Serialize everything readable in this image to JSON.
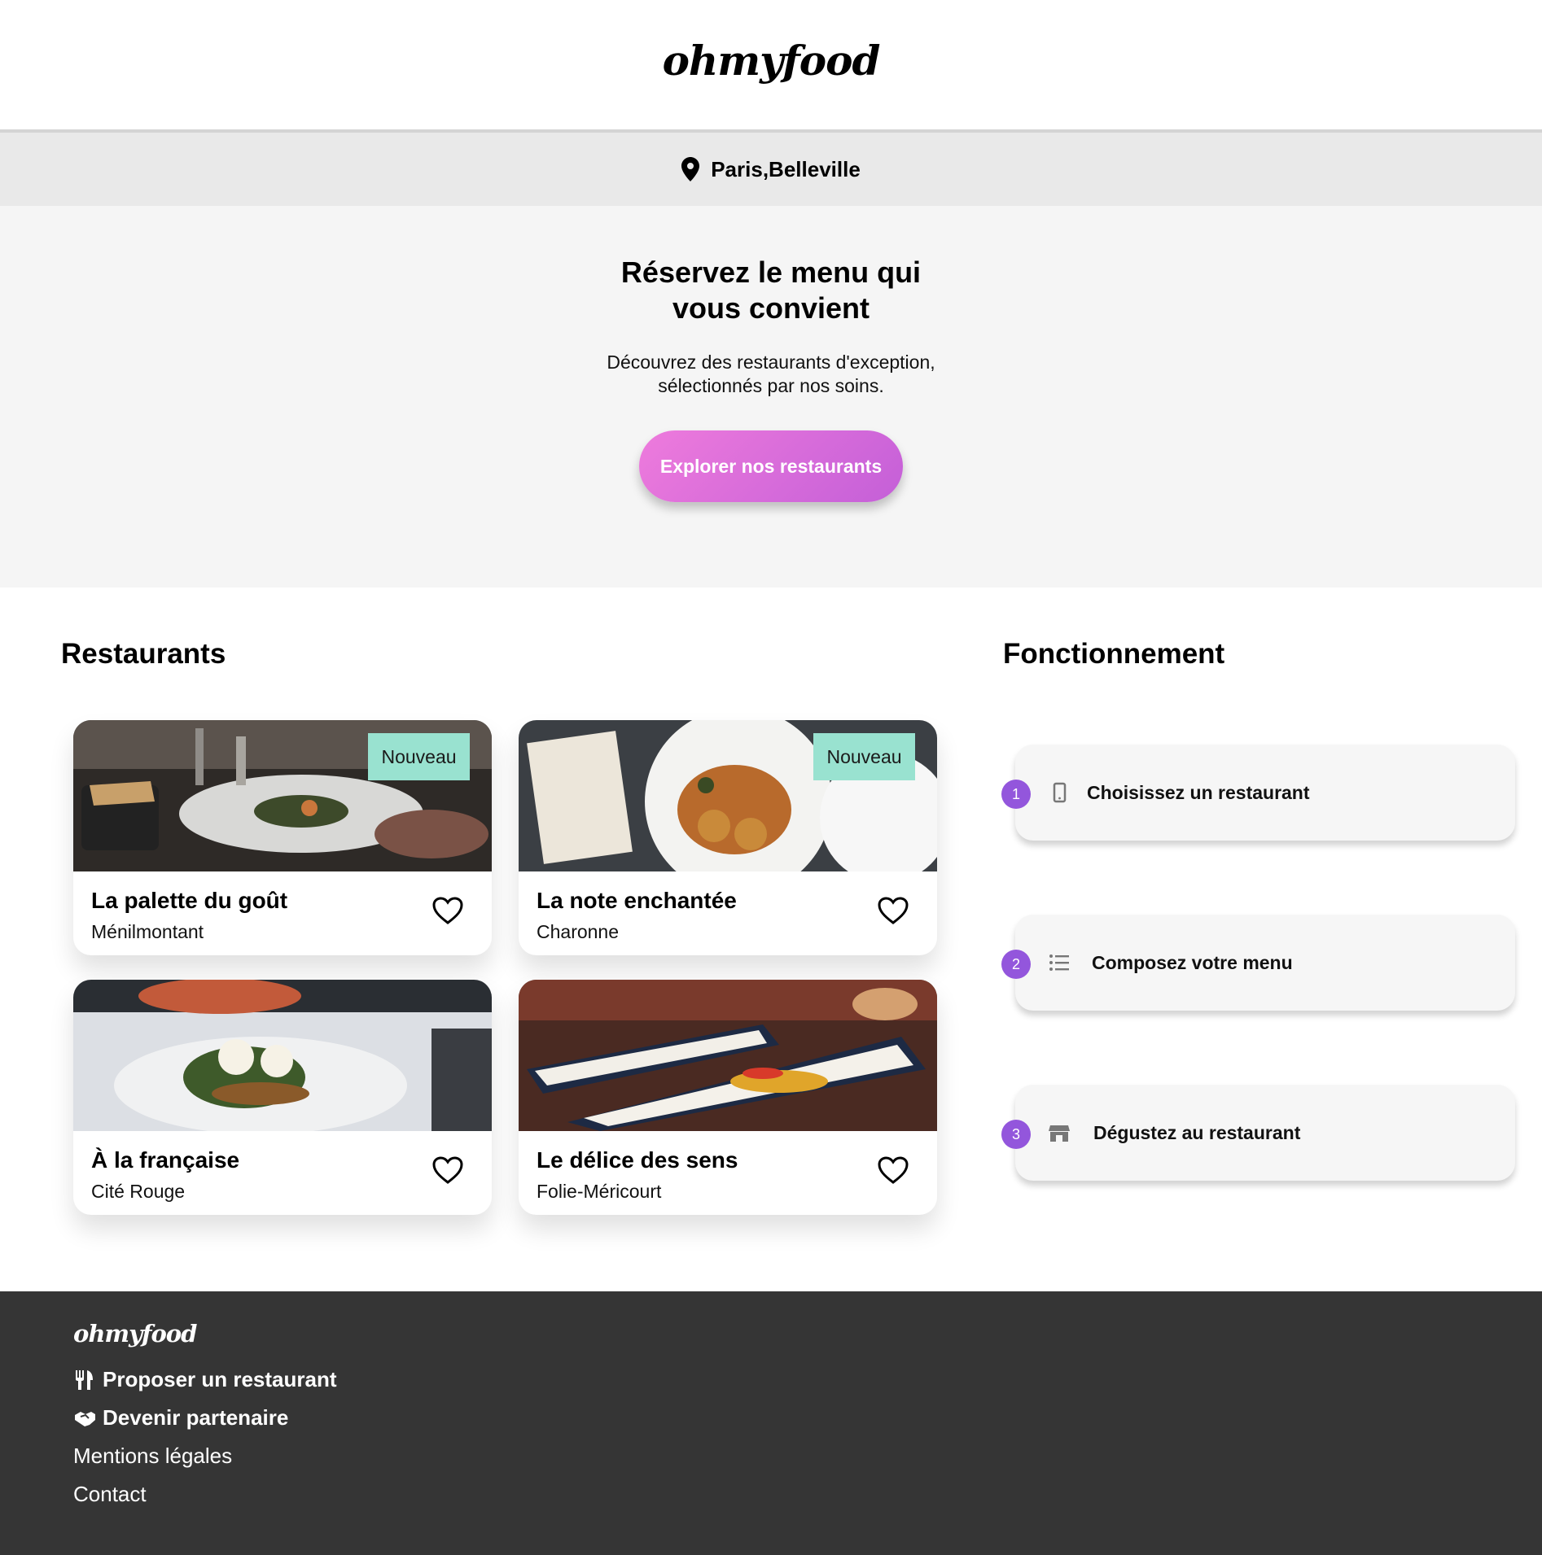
{
  "brand": {
    "logo": "ohmyfood"
  },
  "location": {
    "text": "Paris,Belleville",
    "icon": "map-pin-icon"
  },
  "hero": {
    "title": "Réservez le menu qui vous convient",
    "subtitle": "Découvrez des restaurants d'exception, sélectionnés par nos soins.",
    "cta_label": "Explorer nos restaurants"
  },
  "restaurants": {
    "title": "Restaurants",
    "items": [
      {
        "name": "La palette du goût",
        "area": "Ménilmontant",
        "badge": "Nouveau"
      },
      {
        "name": "La note enchantée",
        "area": "Charonne",
        "badge": "Nouveau"
      },
      {
        "name": "À la française",
        "area": "Cité Rouge",
        "badge": ""
      },
      {
        "name": "Le délice des sens",
        "area": "Folie-Méricourt",
        "badge": ""
      }
    ]
  },
  "fonctionnement": {
    "title": "Fonctionnement",
    "steps": [
      {
        "number": "1",
        "label": "Choisissez un restaurant",
        "icon": "mobile-phone-icon"
      },
      {
        "number": "2",
        "label": "Composez votre menu",
        "icon": "list-icon"
      },
      {
        "number": "3",
        "label": "Dégustez au restaurant",
        "icon": "store-icon"
      }
    ]
  },
  "footer": {
    "logo": "ohmyfood",
    "links": [
      {
        "label": "Proposer un restaurant",
        "icon": "utensils-icon"
      },
      {
        "label": "Devenir partenaire",
        "icon": "handshake-icon"
      },
      {
        "label": "Mentions légales"
      },
      {
        "label": "Contact"
      }
    ]
  },
  "colors": {
    "accent": "#9356dc",
    "cta_start": "#ee7bdc",
    "cta_end": "#c45fd8",
    "badge": "#99e2d0",
    "footer": "#353535"
  }
}
